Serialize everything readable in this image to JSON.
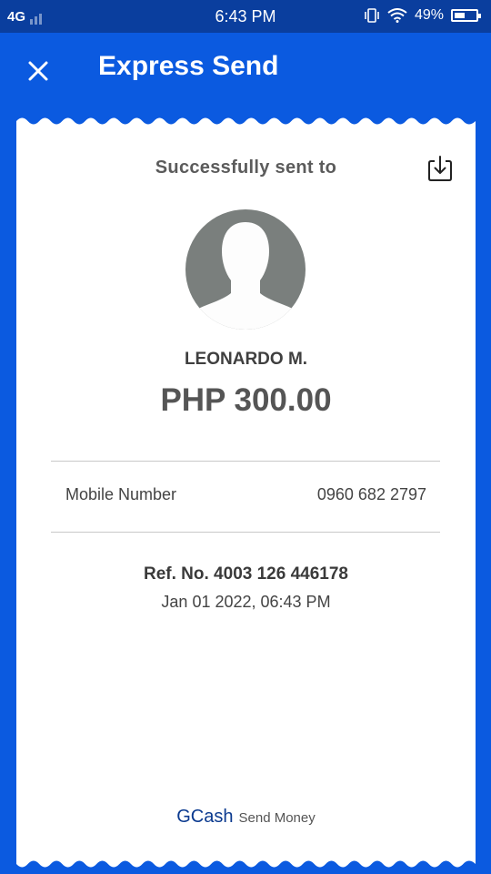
{
  "status_bar": {
    "network": "4G",
    "time": "6:43 PM",
    "battery": "49%",
    "battery_level": 0.49
  },
  "header": {
    "title": "Express Send",
    "close_icon": "close-icon"
  },
  "receipt": {
    "heading": "Successfully sent to",
    "download_icon": "download-icon",
    "recipient_name": "LEONARDO M.",
    "amount": "PHP 300.00",
    "mobile_label": "Mobile Number",
    "mobile_value": "0960 682 2797",
    "reference": "Ref. No. 4003 126 446178",
    "date": "Jan 01 2022, 06:43 PM",
    "brand": "GCash",
    "brand_suffix": "Send Money"
  },
  "colors": {
    "brand_blue": "#0b5ae0",
    "status_bar": "#0a3e9e",
    "avatar_bg": "#7a7f7d"
  }
}
